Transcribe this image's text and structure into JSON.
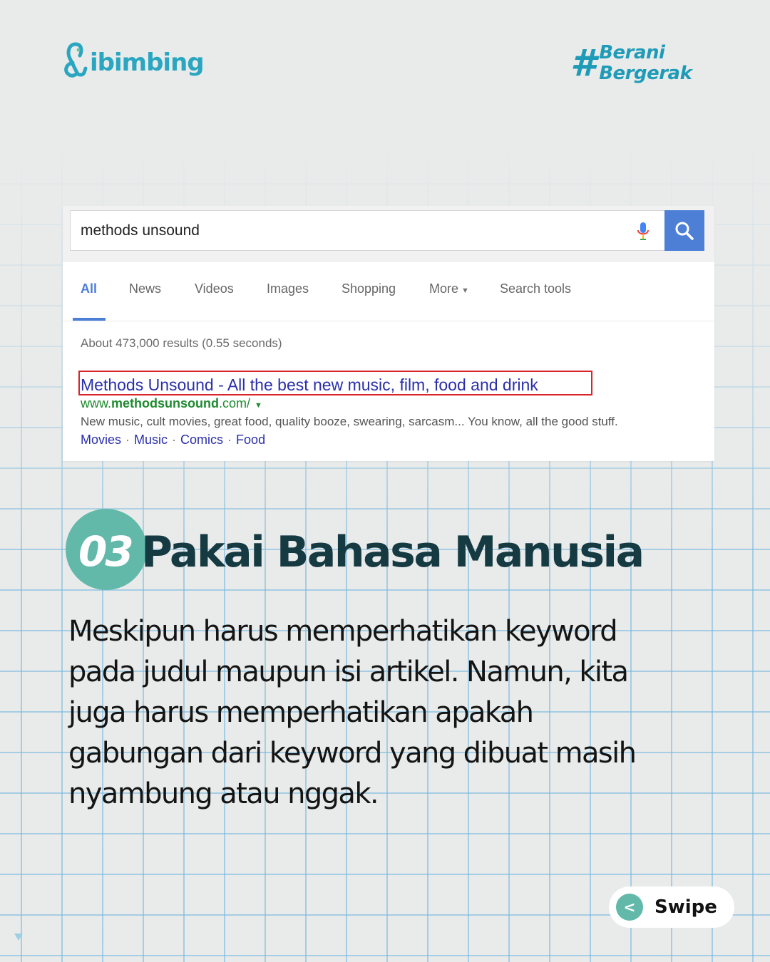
{
  "header": {
    "brand": "ibimbing",
    "tag_hash": "#",
    "tag_line1": "Berani",
    "tag_line2": "Bergerak"
  },
  "search": {
    "query": "methods unsound",
    "tabs": [
      {
        "label": "All",
        "active": true
      },
      {
        "label": "News"
      },
      {
        "label": "Videos"
      },
      {
        "label": "Images"
      },
      {
        "label": "Shopping"
      },
      {
        "label": "More",
        "has_dropdown": true
      },
      {
        "label": "Search tools"
      }
    ],
    "stats": "About 473,000 results (0.55 seconds)",
    "result": {
      "title": "Methods Unsound - All the best new music, film, food and drink",
      "url_prefix": "www.",
      "url_bold": "methodsunsound",
      "url_suffix": ".com/",
      "snippet": "New music, cult movies, great food, quality booze, swearing, sarcasm... You know, all the good stuff.",
      "sitelinks": [
        "Movies",
        "Music",
        "Comics",
        "Food"
      ]
    },
    "colors": {
      "accent": "#4d7fd6",
      "link": "#2a2faa",
      "url": "#1e8a2f",
      "highlight": "#d9252a"
    }
  },
  "section": {
    "number": "03",
    "title": "Pakai Bahasa Manusia",
    "body_lines": [
      "Meskipun harus memperhatikan keyword",
      "pada judul maupun isi artikel. Namun, kita",
      "juga harus memperhatikan apakah",
      "gabungan dari keyword yang dibuat masih",
      "nyambung atau nggak."
    ]
  },
  "nav": {
    "swipe_icon": "<",
    "swipe_label": "Swipe"
  },
  "theme": {
    "teal": "#62b9aa",
    "brand_blue": "#1f9bb8",
    "dark_heading": "#163a42",
    "background": "#e9ebeb"
  }
}
